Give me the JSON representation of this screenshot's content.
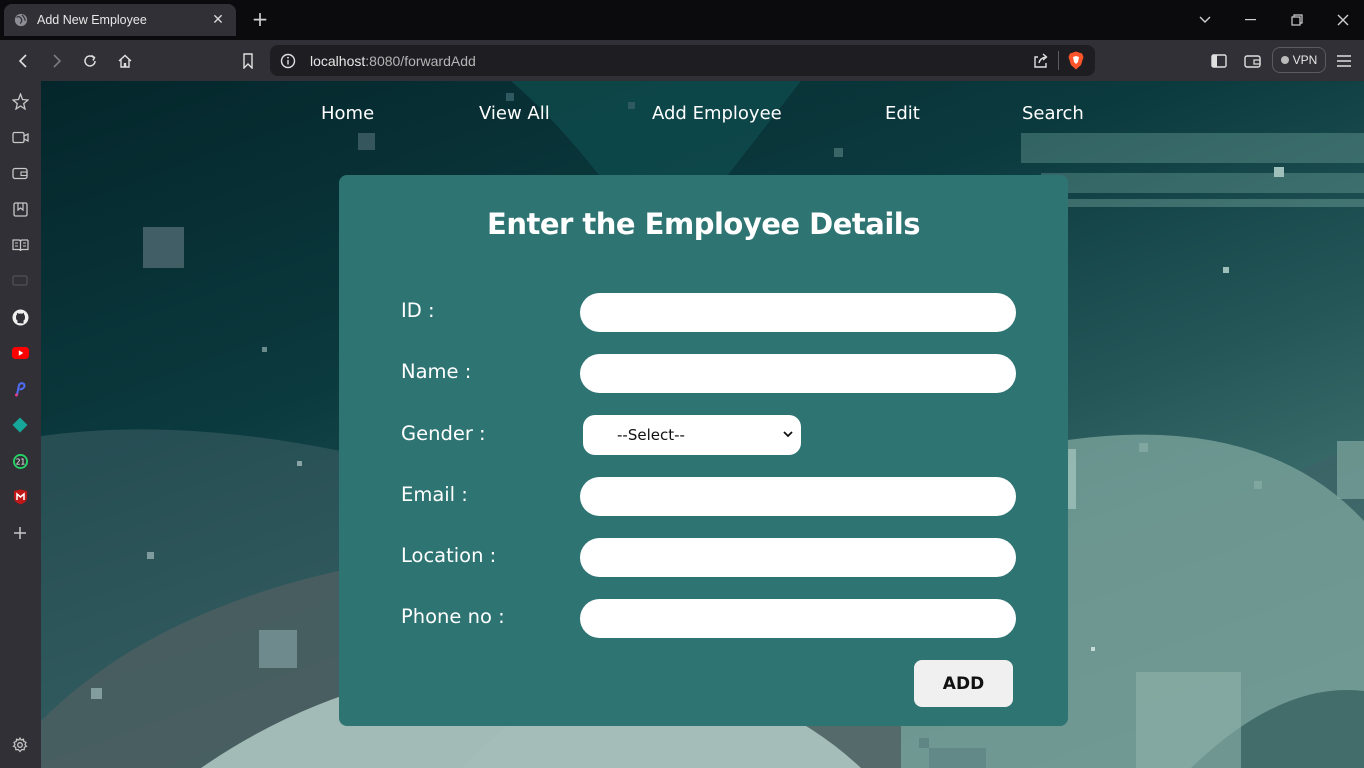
{
  "browser": {
    "tab_title": "Add New Employee",
    "url_host": "localhost",
    "url_rest": ":8080/forwardAdd",
    "vpn_label": "VPN"
  },
  "nav": {
    "items": [
      {
        "label": "Home"
      },
      {
        "label": "View All"
      },
      {
        "label": "Add Employee"
      },
      {
        "label": "Edit"
      },
      {
        "label": "Search"
      }
    ]
  },
  "form": {
    "title": "Enter the Employee Details",
    "id_label": "ID :",
    "name_label": "Name :",
    "gender_label": "Gender :",
    "gender_selected": "--Select--",
    "email_label": "Email :",
    "location_label": "Location :",
    "phone_label": "Phone no :",
    "add_label": "ADD",
    "id_value": "",
    "name_value": "",
    "email_value": "",
    "location_value": "",
    "phone_value": ""
  },
  "sidebar": {
    "icons": [
      "leo-star-icon",
      "video-icon",
      "wallet-icon",
      "bookmarks-icon",
      "reading-list-icon",
      "tv-icon",
      "github-icon",
      "youtube-icon",
      "pen-app-icon",
      "diamond-app-icon",
      "whatsapp-icon",
      "mcafee-icon",
      "add-icon",
      "settings-icon"
    ],
    "whatsapp_badge": "21"
  },
  "colors": {
    "card": "#2e7473",
    "page_bg_dark": "#04262b",
    "chrome": "#303036",
    "tabbar": "#0b0b0d",
    "brave_orange": "#fb542b",
    "youtube_red": "#ff0000",
    "whatsapp_green": "#25d366",
    "mcafee_red": "#c01818"
  }
}
